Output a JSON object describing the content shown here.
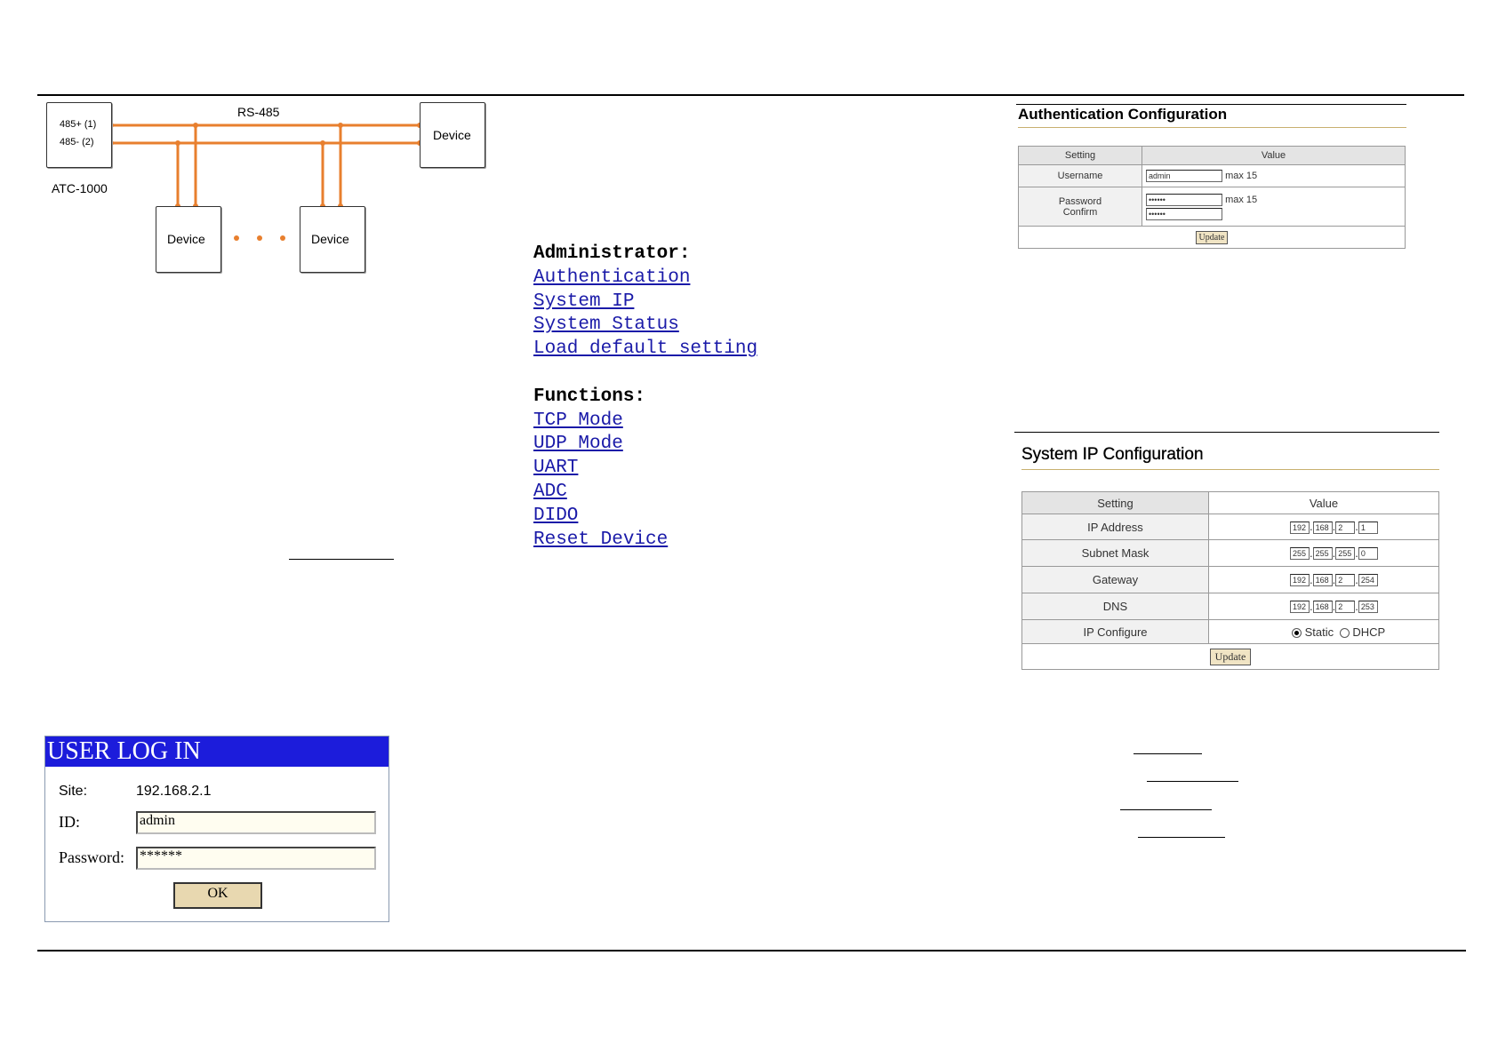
{
  "diagram": {
    "bus_label": "RS-485",
    "pin_plus": "485+ (1)",
    "pin_minus": "485- (2)",
    "controller_label": "ATC-1000",
    "device_right": "Device",
    "device_left": "Device",
    "device_mid": "Device",
    "wire_color": "#e87f2e"
  },
  "menu": {
    "admin_header": "Administrator:",
    "admin_links": [
      "Authentication",
      "System IP",
      "System Status",
      "Load default setting"
    ],
    "func_header": "Functions:",
    "func_links": [
      "TCP Mode",
      "UDP Mode",
      "UART",
      "ADC",
      "DIDO",
      "Reset Device"
    ],
    "link_color": "#1a1aa8"
  },
  "auth": {
    "title": "Authentication Configuration",
    "col_setting": "Setting",
    "col_value": "Value",
    "username_label": "Username",
    "username_value": "admin",
    "username_hint": "max 15",
    "password_label": "Password",
    "confirm_label": "Confirm",
    "password_value": "••••••",
    "confirm_value": "••••••",
    "password_hint": "max 15",
    "update_label": "Update"
  },
  "sysip": {
    "title": "System IP Configuration",
    "col_setting": "Setting",
    "col_value": "Value",
    "rows": [
      {
        "label": "IP Address",
        "octets": [
          "192",
          "168",
          "2",
          "1"
        ]
      },
      {
        "label": "Subnet Mask",
        "octets": [
          "255",
          "255",
          "255",
          "0"
        ]
      },
      {
        "label": "Gateway",
        "octets": [
          "192",
          "168",
          "2",
          "254"
        ]
      },
      {
        "label": "DNS",
        "octets": [
          "192",
          "168",
          "2",
          "253"
        ]
      }
    ],
    "ip_configure_label": "IP Configure",
    "static_label": "Static",
    "dhcp_label": "DHCP",
    "selected": "Static",
    "update_label": "Update"
  },
  "login": {
    "title": "USER LOG IN",
    "site_label": "Site:",
    "site_value": "192.168.2.1",
    "id_label": "ID:",
    "id_value": "admin",
    "password_label": "Password:",
    "password_value": "******",
    "ok_label": "OK",
    "title_bar_color": "#1c1cdb"
  }
}
